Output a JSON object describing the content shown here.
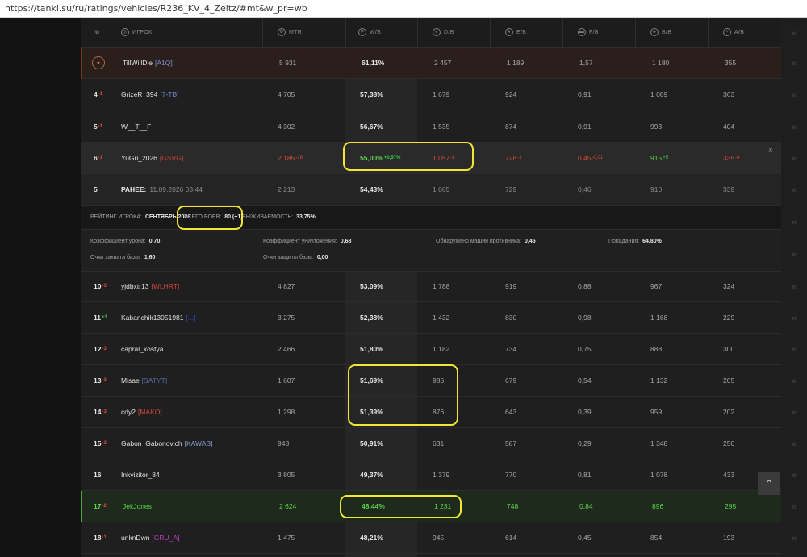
{
  "url": "https://tanki.su/ru/ratings/vehicles/R236_KV_4_Zeitz/#mt&w_pr=wb",
  "headers": {
    "place": "№",
    "player": "ИГРОК",
    "mtr": "MTR",
    "wb": "W/B",
    "db": "D/B",
    "eb": "E/B",
    "fb": "F/B",
    "bb": "B/B",
    "ab": "A/B"
  },
  "rows": [
    {
      "place": "",
      "name": "TillWillDie",
      "clan": "[A1Q]",
      "mtr": "5 931",
      "wb": "61,11%",
      "db": "2 457",
      "eb": "1 189",
      "fb": "1,57",
      "bb": "1 180",
      "ab": "355"
    },
    {
      "place": "4",
      "delta": "-1",
      "name": "GrizeR_394",
      "clan": "[7-TB]",
      "mtr": "4 705",
      "wb": "57,38%",
      "db": "1 679",
      "eb": "924",
      "fb": "0,91",
      "bb": "1 089",
      "ab": "363"
    },
    {
      "place": "5",
      "delta": "-1",
      "name": "W__T__F",
      "clan": "",
      "mtr": "4 302",
      "wb": "56,67%",
      "db": "1 535",
      "eb": "874",
      "fb": "0,91",
      "bb": "993",
      "ab": "404"
    }
  ],
  "selected": {
    "place": "6",
    "delta": "-1",
    "name": "YuGri_2026",
    "clan": "[GSVG]",
    "mtr": "2 185",
    "mtr_d": "-28",
    "wb": "55,00%",
    "wb_d": "+0,57%",
    "db": "1 057",
    "db_d": "-8",
    "eb": "728",
    "eb_d": "-1",
    "fb": "0,45",
    "fb_d": "-0,01",
    "bb": "915",
    "bb_d": "+5",
    "ab": "335",
    "ab_d": "-4"
  },
  "previous": {
    "place": "5",
    "label": "РАНЕЕ:",
    "date": "11.09.2026 03:44",
    "mtr": "2 213",
    "wb": "54,43%",
    "db": "1 065",
    "eb": "729",
    "fb": "0,46",
    "bb": "910",
    "ab": "339"
  },
  "info": {
    "rating_label": "РЕЙТИНГ ИГРОКА:",
    "rating_value": "СЕНТЯБРЬ 2026",
    "battles_label": "ВСЕГО БОЁВ:",
    "battles_value": "80 (+1)",
    "survival_label": "ВЫЖИВАЕМОСТЬ:",
    "survival_value": "33,75%",
    "dmg_label": "Коэффициент урона:",
    "dmg_value": "0,70",
    "kill_label": "Коэффициент уничтожения:",
    "kill_value": "0,68",
    "spot_label": "Обнаружено машин противника:",
    "spot_value": "0,45",
    "hits_label": "Попадания:",
    "hits_value": "64,80%",
    "cap_label": "Очки захвата базы:",
    "cap_value": "1,60",
    "def_label": "Очки защиты базы:",
    "def_value": "0,00"
  },
  "rows2": [
    {
      "place": "10",
      "delta": "-3",
      "name": "yjdbxtr13",
      "clan": "[WLHRT]",
      "clan_color": "#d0453a",
      "mtr": "4 827",
      "wb": "53,09%",
      "db": "1 788",
      "eb": "919",
      "fb": "0,88",
      "bb": "967",
      "ab": "324"
    },
    {
      "place": "11",
      "delta": "+3",
      "name": "Kabanchik13051981",
      "clan": "[...]",
      "clan_color": "#3a48c8",
      "mtr": "3 275",
      "wb": "52,38%",
      "db": "1 432",
      "eb": "830",
      "fb": "0,98",
      "bb": "1 168",
      "ab": "229"
    },
    {
      "place": "12",
      "delta": "-3",
      "name": "capral_kostya",
      "clan": "",
      "clan_color": "",
      "mtr": "2 466",
      "wb": "51,80%",
      "db": "1 182",
      "eb": "734",
      "fb": "0,75",
      "bb": "888",
      "ab": "300"
    },
    {
      "place": "13",
      "delta": "-3",
      "name": "Misae",
      "clan": "[SATYT]",
      "clan_color": "#5a6aa0",
      "mtr": "1 607",
      "wb": "51,69%",
      "db": "985",
      "eb": "679",
      "fb": "0,54",
      "bb": "1 132",
      "ab": "205"
    },
    {
      "place": "14",
      "delta": "-3",
      "name": "cdy2",
      "clan": "[MAKO]",
      "clan_color": "#d0453a",
      "mtr": "1 298",
      "wb": "51,39%",
      "db": "876",
      "eb": "643",
      "fb": "0,39",
      "bb": "959",
      "ab": "202"
    },
    {
      "place": "15",
      "delta": "-2",
      "name": "Gabon_Gabonovich",
      "clan": "[KAWAB]",
      "clan_color": "#8a9ad0",
      "mtr": "948",
      "wb": "50,91%",
      "db": "631",
      "eb": "587",
      "fb": "0,29",
      "bb": "1 348",
      "ab": "250"
    },
    {
      "place": "16",
      "delta": "",
      "name": "Inkvizitor_84",
      "clan": "",
      "clan_color": "",
      "mtr": "3 805",
      "wb": "49,37%",
      "db": "1 379",
      "eb": "770",
      "fb": "0,81",
      "bb": "1 078",
      "ab": "433"
    }
  ],
  "green_row": {
    "place": "17",
    "delta": "-2",
    "name": "JekJones",
    "mtr": "2 624",
    "wb": "48,44%",
    "db": "1 231",
    "eb": "748",
    "fb": "0,84",
    "bb": "896",
    "ab": "295"
  },
  "last_row": {
    "place": "18",
    "delta": "-1",
    "name": "unknDwn",
    "clan": "[GRU_A]",
    "clan_color": "#c040c0",
    "mtr": "1 475",
    "wb": "48,21%",
    "db": "945",
    "eb": "614",
    "fb": "0,45",
    "bb": "854",
    "ab": "193"
  },
  "icons": {
    "side_arrow": "«",
    "scroll_top": "⌃",
    "close": "×",
    "medal": "★"
  }
}
